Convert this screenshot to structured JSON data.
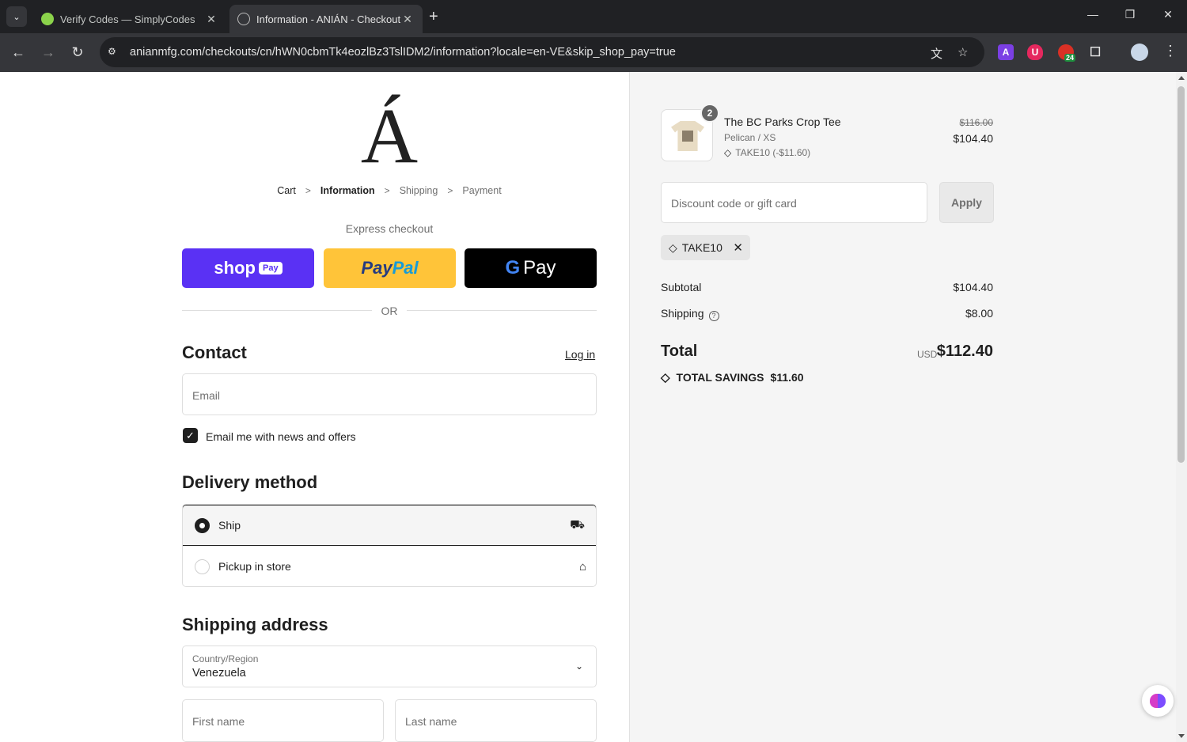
{
  "browser": {
    "tabs": [
      {
        "title": "Verify Codes — SimplyCodes",
        "close": "✕"
      },
      {
        "title": "Information - ANIÁN - Checkout",
        "close": "✕"
      }
    ],
    "new_tab": "+",
    "url": "anianmfg.com/checkouts/cn/hWN0cbmTk4eozlBz3TslIDM2/information?locale=en-VE&skip_shop_pay=true",
    "ext_badge": "24",
    "ext_a_letter": "A"
  },
  "store": {
    "logo_text": "Á"
  },
  "breadcrumb": {
    "cart": "Cart",
    "information": "Information",
    "shipping": "Shipping",
    "payment": "Payment",
    "sep": ">"
  },
  "express": {
    "label": "Express checkout",
    "shop": "shop",
    "shop_pill": "Pay",
    "paypal_1": "Pay",
    "paypal_2": "Pal",
    "gpay_g": "G",
    "gpay_text": "Pay",
    "or": "OR"
  },
  "contact": {
    "heading": "Contact",
    "login": "Log in",
    "email_placeholder": "Email",
    "newsletter_label": "Email me with news and offers",
    "newsletter_checked": true
  },
  "delivery": {
    "heading": "Delivery method",
    "options": [
      {
        "label": "Ship",
        "selected": true
      },
      {
        "label": "Pickup in store",
        "selected": false
      }
    ]
  },
  "shipping_address": {
    "heading": "Shipping address",
    "country_label": "Country/Region",
    "country_value": "Venezuela",
    "first_name_placeholder": "First name",
    "last_name_placeholder": "Last name"
  },
  "summary": {
    "item": {
      "name": "The BC Parks Crop Tee",
      "variant": "Pelican / XS",
      "discount": "TAKE10 (-$11.60)",
      "quantity": "2",
      "price_original": "$116.00",
      "price": "$104.40"
    },
    "discount_placeholder": "Discount code or gift card",
    "apply": "Apply",
    "applied_code": "TAKE10",
    "subtotal_label": "Subtotal",
    "subtotal": "$104.40",
    "shipping_label": "Shipping",
    "shipping": "$8.00",
    "total_label": "Total",
    "currency": "USD",
    "total": "$112.40",
    "savings_label": "TOTAL SAVINGS",
    "savings": "$11.60"
  },
  "colors": {
    "shop_pay": "#5a31f4",
    "paypal": "#ffc439",
    "gpay": "#000000",
    "summary_bg": "#f5f5f5"
  }
}
